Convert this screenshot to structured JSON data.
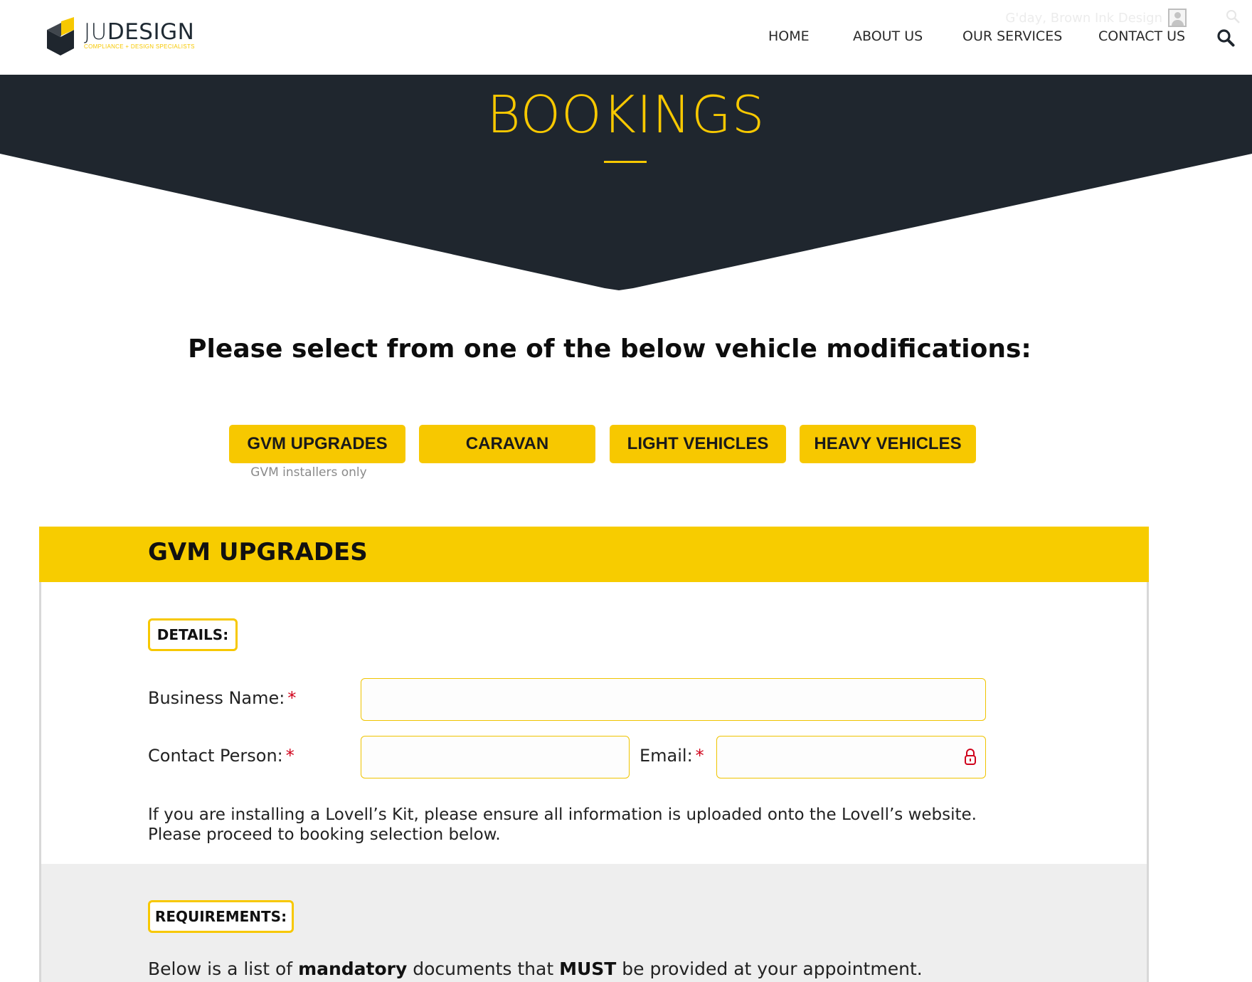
{
  "header": {
    "logo": {
      "brand_part1": "JU",
      "brand_part2": "DESIGN",
      "tagline": "COMPLIANCE + DESIGN SPECIALISTS"
    },
    "greeting": "G'day, Brown Ink Design",
    "nav": [
      "HOME",
      "ABOUT US",
      "OUR SERVICES",
      "CONTACT US"
    ],
    "icons": {
      "search": "search-icon",
      "user": "user-avatar-icon"
    }
  },
  "hero": {
    "title": "BOOKINGS"
  },
  "selection": {
    "heading": "Please select from one of the below vehicle modifications:",
    "buttons": [
      {
        "label": "GVM UPGRADES",
        "note": "GVM installers only"
      },
      {
        "label": "CARAVAN"
      },
      {
        "label": "LIGHT VEHICLES"
      },
      {
        "label": "HEAVY VEHICLES"
      }
    ]
  },
  "form": {
    "title": "GVM UPGRADES",
    "details_tag": "DETAILS:",
    "fields": {
      "business_name": {
        "label": "Business Name:",
        "value": "",
        "required_mark": "*"
      },
      "contact_person": {
        "label": "Contact Person:",
        "value": "",
        "required_mark": "*"
      },
      "email": {
        "label": "Email:",
        "value": "",
        "required_mark": "*"
      }
    },
    "info_line1": "If you are installing a Lovell’s Kit, please ensure all information is uploaded onto the Lovell’s website.",
    "info_line2": "Please proceed to booking selection below.",
    "requirements_tag": "REQUIREMENTS:",
    "requirements_text": {
      "part1": "Below is a list of ",
      "bold1": "mandatory",
      "part2": " documents that ",
      "bold2": "MUST",
      "part3": " be provided at your appointment."
    }
  },
  "colors": {
    "accent": "#f7c800",
    "dark": "#1f262e",
    "required": "#d0021b",
    "panel_grey": "#eeeeee"
  }
}
